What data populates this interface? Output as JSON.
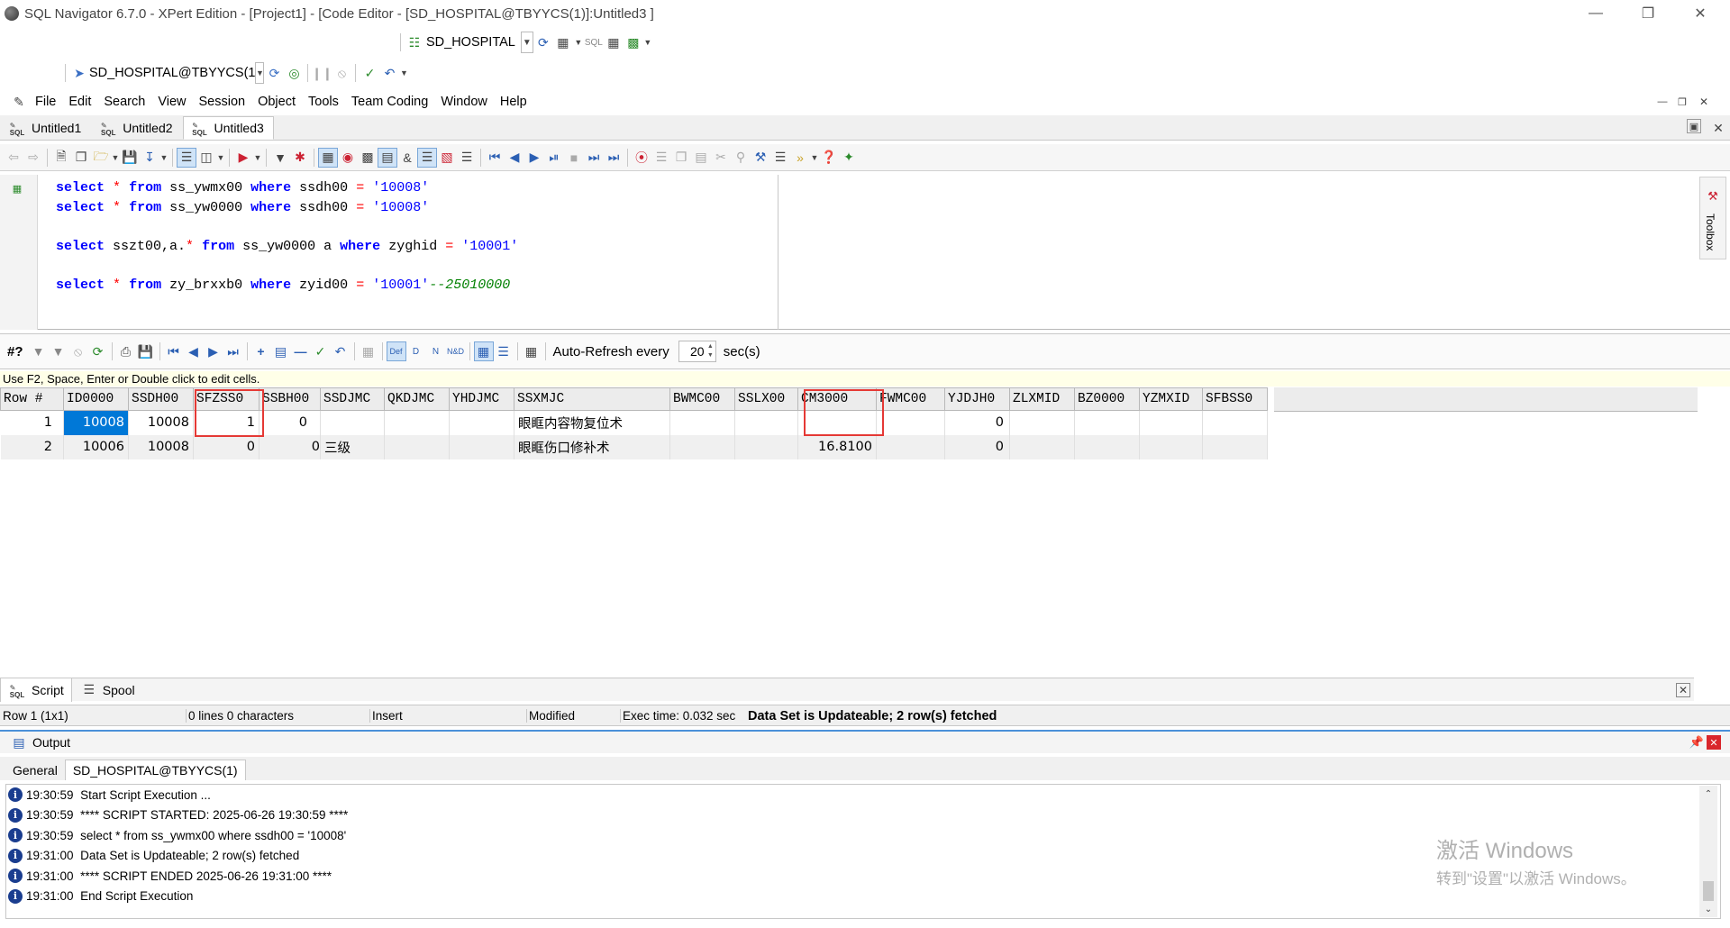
{
  "window": {
    "title": "SQL Navigator 6.7.0 - XPert Edition - [Project1] - [Code Editor - [SD_HOSPITAL@TBYYCS(1)]:Untitled3 ]"
  },
  "toolbar1": {
    "connection_label": "SD_HOSPITAL"
  },
  "toolbar2": {
    "session_label": "SD_HOSPITAL@TBYYCS(1"
  },
  "menu": [
    "File",
    "Edit",
    "Search",
    "View",
    "Session",
    "Object",
    "Tools",
    "Team Coding",
    "Window",
    "Help"
  ],
  "doc_tabs": [
    {
      "label": "Untitled1"
    },
    {
      "label": "Untitled2"
    },
    {
      "label": "Untitled3"
    }
  ],
  "editor": {
    "lines": [
      {
        "kw1": "select",
        "op1": "*",
        "kw2": "from",
        "t1": "ss_ywmx00",
        "kw3": "where",
        "t2": "ssdh00",
        "op2": "=",
        "str": "'10008'",
        "cm": ""
      },
      {
        "kw1": "select",
        "op1": "*",
        "kw2": "from",
        "t1": "ss_yw0000",
        "kw3": "where",
        "t2": "ssdh00",
        "op2": "=",
        "str": "'10008'",
        "cm": ""
      },
      {
        "kw1": "select",
        "pre": "sszt00,a.",
        "op1": "*",
        "kw2": "from",
        "t1": "ss_yw0000 a",
        "kw3": "where",
        "t2": "zyghid",
        "op2": "=",
        "str": "'10001'",
        "cm": ""
      },
      {
        "kw1": "select",
        "op1": "*",
        "kw2": "from",
        "t1": "zy_brxxb0",
        "kw3": "where",
        "t2": "zyid00",
        "op2": "=",
        "str": "'10001'",
        "cm": "--25010000"
      }
    ],
    "toolbox_label": "Toolbox"
  },
  "grid_toolbar": {
    "query_label": "#?",
    "auto_refresh_label": "Auto-Refresh every",
    "refresh_value": "20",
    "unit_label": "sec(s)"
  },
  "grid_hint": "Use F2, Space, Enter or Double click to edit cells.",
  "grid": {
    "columns": [
      "Row #",
      "ID0000",
      "SSDH00",
      "SFZSS0",
      "SSBH00",
      "SSDJMC",
      "QKDJMC",
      "YHDJMC",
      "SSXMJC",
      "BWMC00",
      "SSLX00",
      "CM3000",
      "FWMC00",
      "YJDJH0",
      "ZLXMID",
      "BZ0000",
      "YZMXID",
      "SFBSS0"
    ],
    "rows": [
      [
        "1",
        "10008",
        "10008",
        "1",
        "0",
        "",
        "",
        "",
        "眼眶内容物复位术",
        "",
        "",
        "",
        "",
        "0",
        "",
        "",
        "",
        ""
      ],
      [
        "2",
        "10006",
        "10008",
        "0",
        "0",
        "三级",
        "",
        "",
        "眼眶伤口修补术",
        "",
        "",
        "16.8100",
        "",
        "0",
        "",
        "",
        "",
        ""
      ]
    ]
  },
  "bottom_tabs": [
    {
      "label": "Script"
    },
    {
      "label": "Spool"
    }
  ],
  "status": {
    "position": "Row 1 (1x1)",
    "lines": "0 lines 0 characters",
    "mode": "Insert",
    "modified": "Modified",
    "exec_time": "Exec time: 0.032 sec",
    "message": "Data Set is Updateable; 2 row(s) fetched"
  },
  "output": {
    "title": "Output",
    "tabs": [
      {
        "label": "General"
      },
      {
        "label": "SD_HOSPITAL@TBYYCS(1)"
      }
    ],
    "log": [
      {
        "time": "19:30:59",
        "text": "Start Script Execution ..."
      },
      {
        "time": "19:30:59",
        "text": "**** SCRIPT STARTED: 2025-06-26 19:30:59 ****"
      },
      {
        "time": "19:30:59",
        "text": "select * from ss_ywmx00 where ssdh00 = '10008'"
      },
      {
        "time": "19:31:00",
        "text": "Data Set is Updateable; 2 row(s) fetched"
      },
      {
        "time": "19:31:00",
        "text": "**** SCRIPT ENDED 2025-06-26 19:31:00 ****"
      },
      {
        "time": "19:31:00",
        "text": "End Script Execution"
      }
    ]
  },
  "watermark": {
    "line1": "激活 Windows",
    "line2": "转到\"设置\"以激活 Windows。"
  },
  "colors": {
    "selection": "#0078d7",
    "highlight_box": "#e53935",
    "keyword": "#0000ff",
    "comment": "#008000"
  }
}
